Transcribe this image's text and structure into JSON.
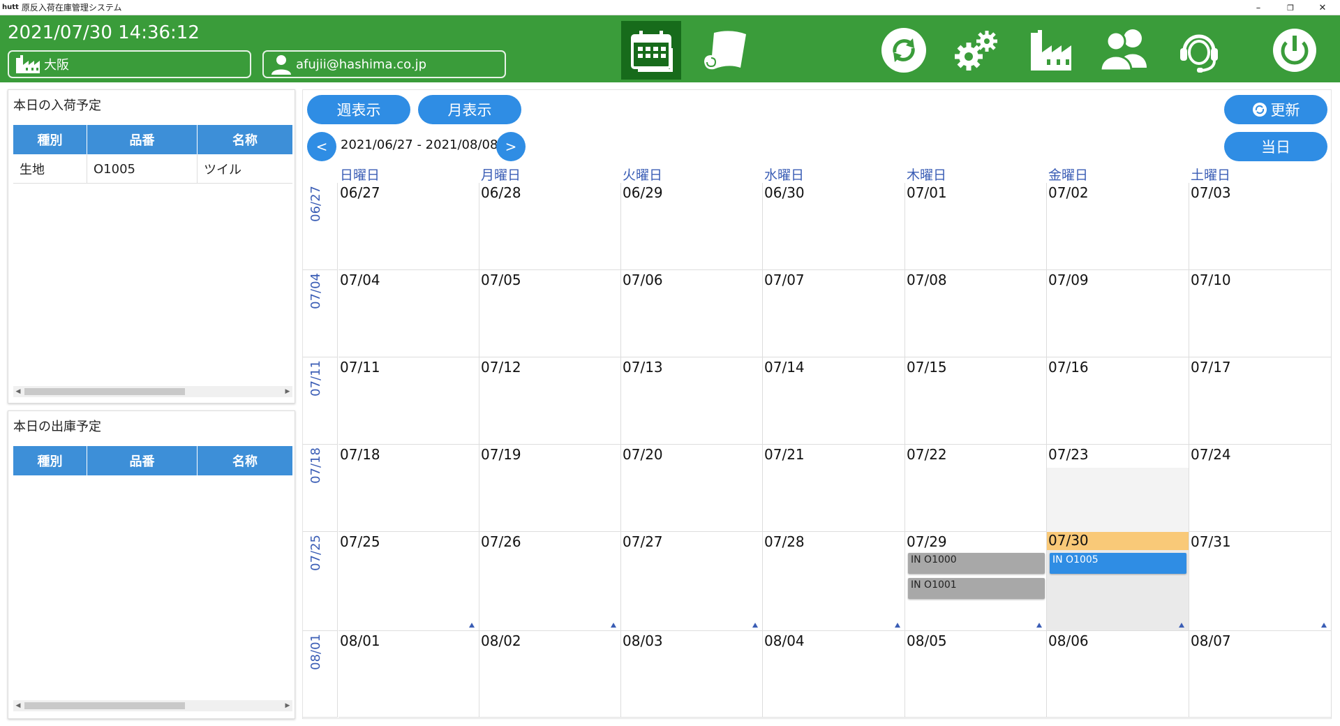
{
  "window": {
    "app_icon": "hutt",
    "title": "原反入荷在庫管理システム",
    "minimize": "–",
    "restore": "❐",
    "close": "✕"
  },
  "header": {
    "datetime": "2021/07/30 14:36:12",
    "location": "大阪",
    "user": "afujii@hashima.co.jp",
    "nav_icons": [
      "calendar-icon",
      "fabric-roll-icon",
      "sync-icon",
      "gears-icon",
      "factory-icon",
      "users-icon",
      "support-headset-icon",
      "power-icon"
    ],
    "active_nav": "calendar-icon"
  },
  "arrivals_panel": {
    "title": "本日の入荷予定",
    "columns": [
      "種別",
      "品番",
      "名称"
    ],
    "rows": [
      [
        "生地",
        "O1005",
        "ツイル"
      ]
    ]
  },
  "shipments_panel": {
    "title": "本日の出庫予定",
    "columns": [
      "種別",
      "品番",
      "名称"
    ],
    "rows": []
  },
  "calendar_toolbar": {
    "week_view": "週表示",
    "month_view": "月表示",
    "prev": "<",
    "next": ">",
    "range": "2021/06/27 - 2021/08/08",
    "refresh": "更新",
    "today": "当日"
  },
  "calendar": {
    "day_headers": [
      "日曜日",
      "月曜日",
      "火曜日",
      "水曜日",
      "木曜日",
      "金曜日",
      "土曜日"
    ],
    "weeks": [
      {
        "label": "06/27",
        "days": [
          "06/27",
          "06/28",
          "06/29",
          "06/30",
          "07/01",
          "07/02",
          "07/03"
        ]
      },
      {
        "label": "07/04",
        "days": [
          "07/04",
          "07/05",
          "07/06",
          "07/07",
          "07/08",
          "07/09",
          "07/10"
        ]
      },
      {
        "label": "07/11",
        "days": [
          "07/11",
          "07/12",
          "07/13",
          "07/14",
          "07/15",
          "07/16",
          "07/17"
        ]
      },
      {
        "label": "07/18",
        "days": [
          "07/18",
          "07/19",
          "07/20",
          "07/21",
          "07/22",
          "07/23",
          "07/24"
        ]
      },
      {
        "label": "07/25",
        "days": [
          "07/25",
          "07/26",
          "07/27",
          "07/28",
          "07/29",
          "07/30",
          "07/31"
        ]
      },
      {
        "label": "08/01",
        "days": [
          "08/01",
          "08/02",
          "08/03",
          "08/04",
          "08/05",
          "08/06",
          "08/07"
        ]
      }
    ],
    "today": "07/30",
    "events": [
      {
        "date": "07/29",
        "text": "IN O1000",
        "status": "past"
      },
      {
        "date": "07/29",
        "text": "IN O1001",
        "status": "past"
      },
      {
        "date": "07/30",
        "text": "IN O1005",
        "status": "today"
      }
    ]
  },
  "colors": {
    "header_green": "#3a9c3a",
    "active_nav": "#176b1b",
    "accent_blue": "#2f8de4",
    "today_highlight": "#f9c978",
    "past_event": "#a8a8a8"
  }
}
